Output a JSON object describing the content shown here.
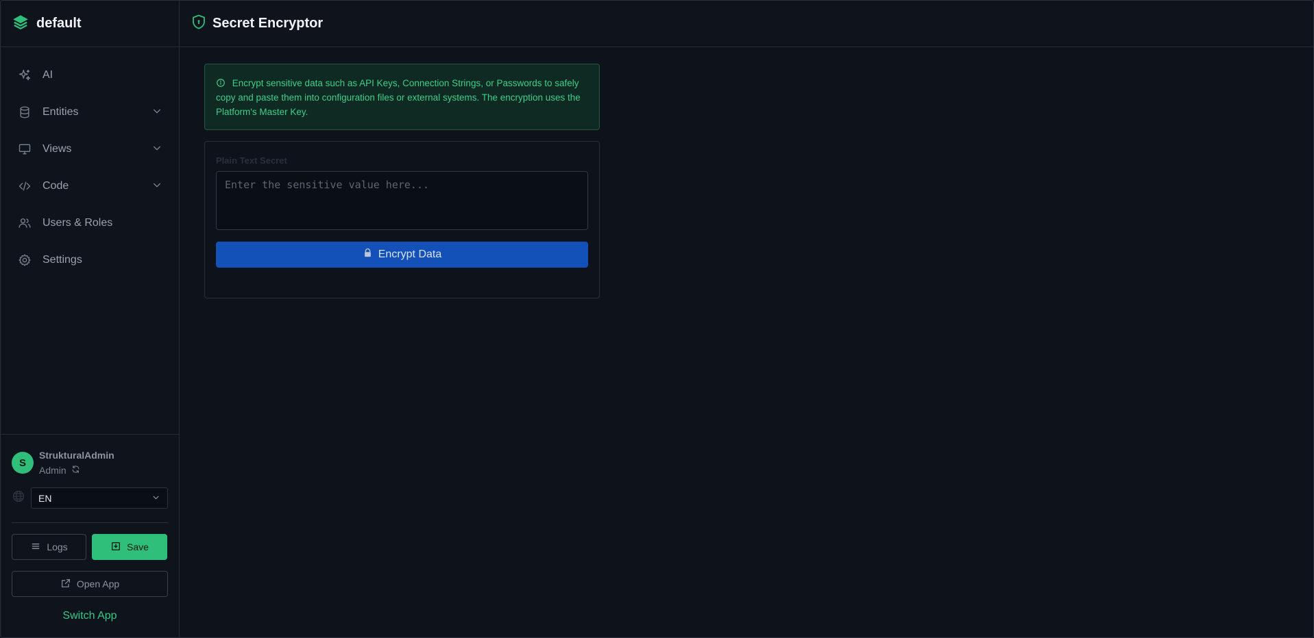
{
  "brand": {
    "name": "default",
    "logo_icon": "layers-icon"
  },
  "nav": {
    "items": [
      {
        "label": "AI",
        "icon": "sparkles-icon",
        "expandable": false
      },
      {
        "label": "Entities",
        "icon": "database-icon",
        "expandable": true
      },
      {
        "label": "Views",
        "icon": "monitor-icon",
        "expandable": true
      },
      {
        "label": "Code",
        "icon": "code-icon",
        "expandable": true
      },
      {
        "label": "Users & Roles",
        "icon": "users-icon",
        "expandable": false
      },
      {
        "label": "Settings",
        "icon": "gear-icon",
        "expandable": false
      }
    ]
  },
  "user": {
    "initial": "S",
    "name": "StrukturalAdmin",
    "role": "Admin"
  },
  "language": {
    "selected": "EN"
  },
  "actions": {
    "logs_label": "Logs",
    "save_label": "Save",
    "open_app_label": "Open App",
    "switch_app_label": "Switch App"
  },
  "header": {
    "title": "Secret Encryptor",
    "icon": "shield-icon"
  },
  "info": {
    "text": "Encrypt sensitive data such as API Keys, Connection Strings, or Passwords to safely copy and paste them into configuration files or external systems. The encryption uses the Platform's Master Key."
  },
  "form": {
    "field_label": "Plain Text Secret",
    "placeholder": "Enter the sensitive value here...",
    "value": "",
    "button_label": "Encrypt Data"
  },
  "colors": {
    "accent_green": "#2fbf7a",
    "primary_blue": "#1350b8",
    "background": "#0d121b",
    "sidebar": "#0f141c",
    "info_bg": "#0f2a22",
    "info_text": "#3ecf8a"
  }
}
